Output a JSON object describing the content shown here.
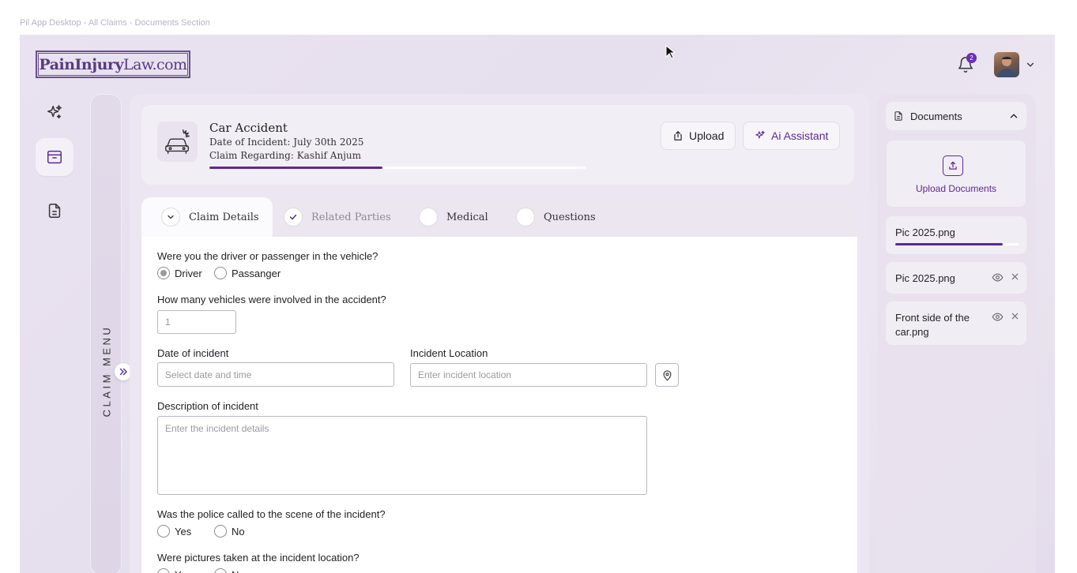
{
  "frame_label": "Pil App Desktop - All Claims - Documents Section",
  "logo": {
    "bold": "PainInjury",
    "light": "Law.com"
  },
  "notifications": {
    "count": "2"
  },
  "sidebar": {
    "claim_menu_label": "CLAIM MENU"
  },
  "case": {
    "title": "Car Accident",
    "date_line": "Date of Incident: July 30th 2025",
    "regarding_line": "Claim Regarding: Kashif Anjum",
    "progress": 0.46
  },
  "actions": {
    "upload_label": "Upload",
    "ai_label": "Ai Assistant"
  },
  "tabs": [
    {
      "label": "Claim Details",
      "state": "active"
    },
    {
      "label": "Related Parties",
      "state": "done"
    },
    {
      "label": "Medical",
      "state": "pending"
    },
    {
      "label": "Questions",
      "state": "pending"
    }
  ],
  "form": {
    "q_driver": "Were you the driver or passenger in the vehicle?",
    "opt_driver": "Driver",
    "opt_passenger": "Passanger",
    "driver_selected": "Driver",
    "q_vehicles": "How many vehicles were involved in the accident?",
    "vehicles_placeholder": "1",
    "date_label": "Date of incident",
    "date_placeholder": "Select date and time",
    "location_label": "Incident Location",
    "location_placeholder": "Enter incident location",
    "desc_label": "Description of incident",
    "desc_placeholder": "Enter the incident details",
    "q_police": "Was the police called to the scene of the incident?",
    "opt_yes": "Yes",
    "opt_no": "No",
    "q_pictures": "Were pictures taken at the incident location?"
  },
  "documents": {
    "header": "Documents",
    "upload_label": "Upload Documents",
    "uploading": {
      "name": "Pic 2025.png",
      "progress": 0.87
    },
    "files": [
      {
        "name": "Pic 2025.png"
      },
      {
        "name": "Front side of the car.png"
      }
    ]
  },
  "colors": {
    "accent": "#5b2a93",
    "badge": "#6a2fb3"
  }
}
